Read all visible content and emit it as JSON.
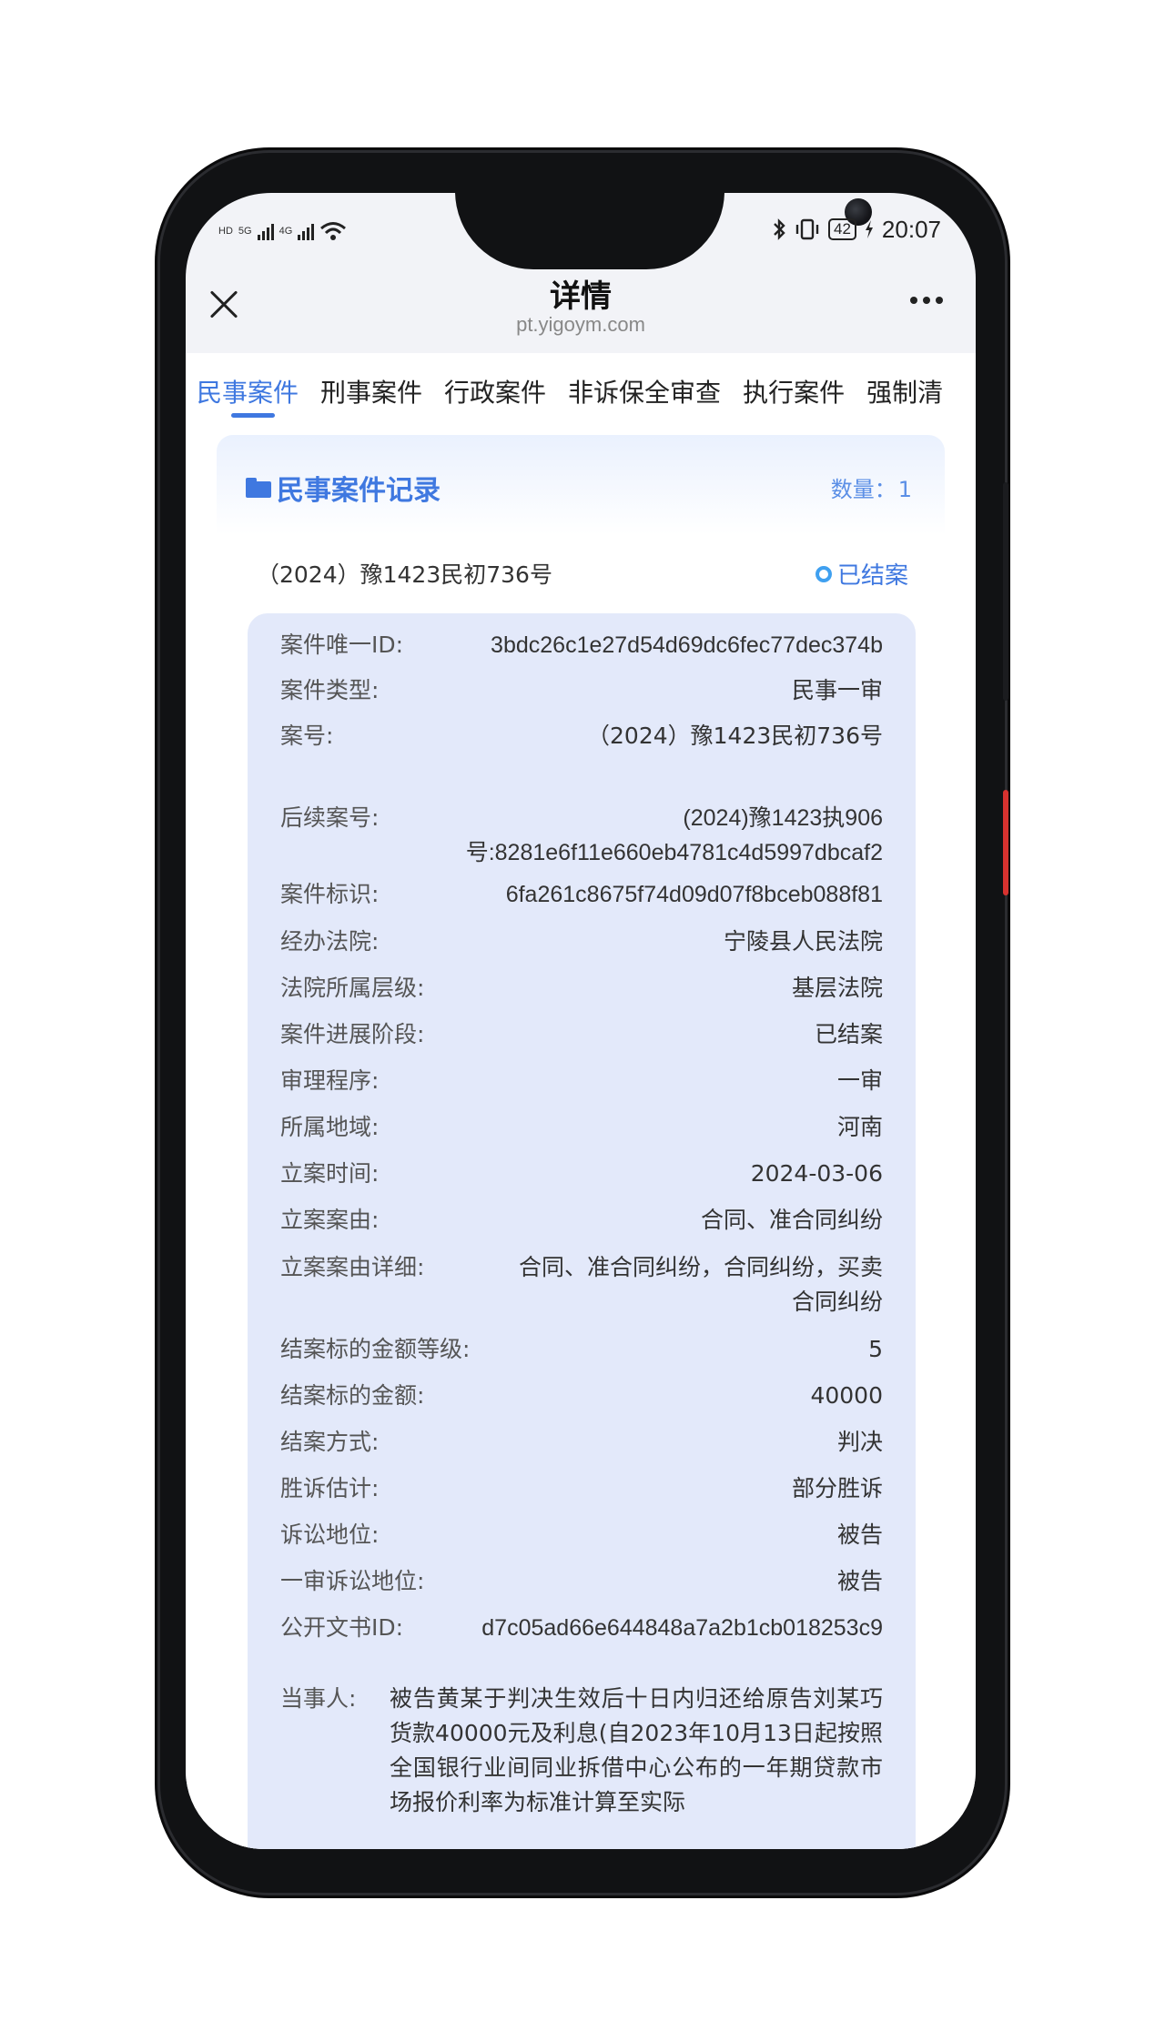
{
  "status_bar": {
    "left_tags": [
      "HD",
      "5G",
      "4G"
    ],
    "time": "20:07",
    "battery": "42"
  },
  "header": {
    "title": "详情",
    "domain": "pt.yigoym.com"
  },
  "tabs": [
    "民事案件",
    "刑事案件",
    "行政案件",
    "非诉保全审查",
    "执行案件",
    "强制清"
  ],
  "card": {
    "title": "民事案件记录",
    "count_label": "数量：",
    "count_value": "1",
    "case_number": "（2024）豫1423民初736号",
    "status": "已结案"
  },
  "rows": [
    {
      "k": "案件唯一ID:",
      "v": "3bdc26c1e27d54d69dc6fec77dec374b"
    },
    {
      "k": "案件类型:",
      "v": "民事一审"
    },
    {
      "k": "案号:",
      "v": "（2024）豫1423民初736号"
    },
    {
      "k": "后续案号:",
      "v": "(2024)豫1423执906号:8281e6f11e660eb4781c4d5997dbcaf2"
    },
    {
      "k": "案件标识:",
      "v": "6fa261c8675f74d09d07f8bceb088f81"
    },
    {
      "k": "经办法院:",
      "v": "宁陵县人民法院"
    },
    {
      "k": "法院所属层级:",
      "v": "基层法院"
    },
    {
      "k": "案件进展阶段:",
      "v": "已结案"
    },
    {
      "k": "审理程序:",
      "v": "一审"
    },
    {
      "k": "所属地域:",
      "v": "河南"
    },
    {
      "k": "立案时间:",
      "v": "2024-03-06"
    },
    {
      "k": "立案案由:",
      "v": "合同、准合同纠纷"
    },
    {
      "k": "立案案由详细:",
      "v": "合同、准合同纠纷，合同纠纷，买卖合同纠纷"
    },
    {
      "k": "结案标的金额等级:",
      "v": "5"
    },
    {
      "k": "结案标的金额:",
      "v": "40000"
    },
    {
      "k": "结案方式:",
      "v": "判决"
    },
    {
      "k": "胜诉估计:",
      "v": "部分胜诉"
    },
    {
      "k": "诉讼地位:",
      "v": "被告"
    },
    {
      "k": "一审诉讼地位:",
      "v": "被告"
    },
    {
      "k": "公开文书ID:",
      "v": "d7c05ad66e644848a7a2b1cb018253c9"
    }
  ],
  "party": {
    "k": "当事人:",
    "v": "被告黄某于判决生效后十日内归还给原告刘某巧货款40000元及利息(自2023年10月13日起按照全国银行业间同业拆借中心公布的一年期贷款市场报价利率为标准计算至实际"
  }
}
